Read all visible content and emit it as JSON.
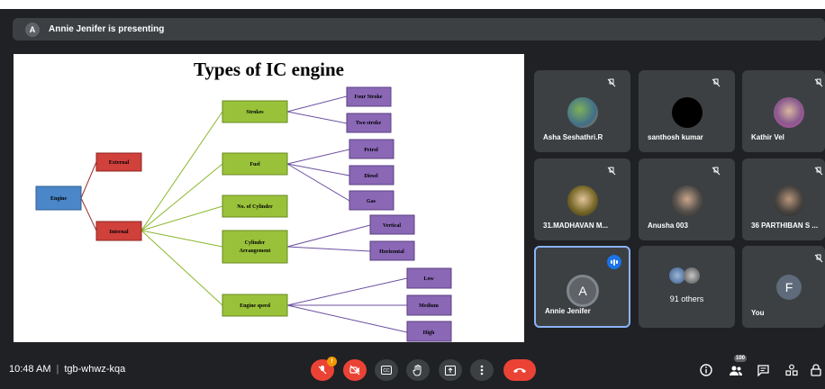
{
  "banner": {
    "initial": "A",
    "text": "Annie Jenifer is presenting"
  },
  "slide": {
    "title": "Types of IC engine",
    "nodes": {
      "engine": "Engine",
      "external": "External",
      "internal": "Internal",
      "strokes": "Strokes",
      "four_stroke": "Four Stroke",
      "two_stroke": "Two stroke",
      "fuel": "Fuel",
      "petrol": "Petrol",
      "diesel": "Diesel",
      "gas": "Gas",
      "no_cylinder": "No. of Cylinder",
      "cyl_arr_1": "Cylinder",
      "cyl_arr_2": "Arrangement",
      "vertical": "Vertical",
      "horizontal": "Horizontal",
      "engine_speed": "Engine speed",
      "low": "Low",
      "medium": "Medium",
      "high": "High"
    }
  },
  "participants": [
    {
      "name": "Asha Seshathri.R"
    },
    {
      "name": "santhosh kumar"
    },
    {
      "name": "Kathir Vel"
    },
    {
      "name": "31.MADHAVAN M..."
    },
    {
      "name": "Anusha 003"
    },
    {
      "name": "36 PARTHIBAN S ..."
    },
    {
      "name": "Annie Jenifer",
      "initial": "A"
    },
    {
      "name": "91 others"
    },
    {
      "name": "You",
      "initial": "F"
    }
  ],
  "bottom": {
    "time": "10:48 AM",
    "meeting_code": "tgb-whwz-kqa",
    "mic_badge": "!",
    "people_count": "100"
  },
  "colors": {
    "background": "#202124",
    "tile": "#3c4043",
    "accent": "#8ab4f8",
    "danger": "#ea4335"
  },
  "icons": [
    "mic-off-icon",
    "camera-off-icon",
    "captions-icon",
    "raise-hand-icon",
    "present-icon",
    "more-icon",
    "end-call-icon",
    "info-icon",
    "people-icon",
    "chat-icon",
    "activities-icon",
    "lock-icon"
  ]
}
